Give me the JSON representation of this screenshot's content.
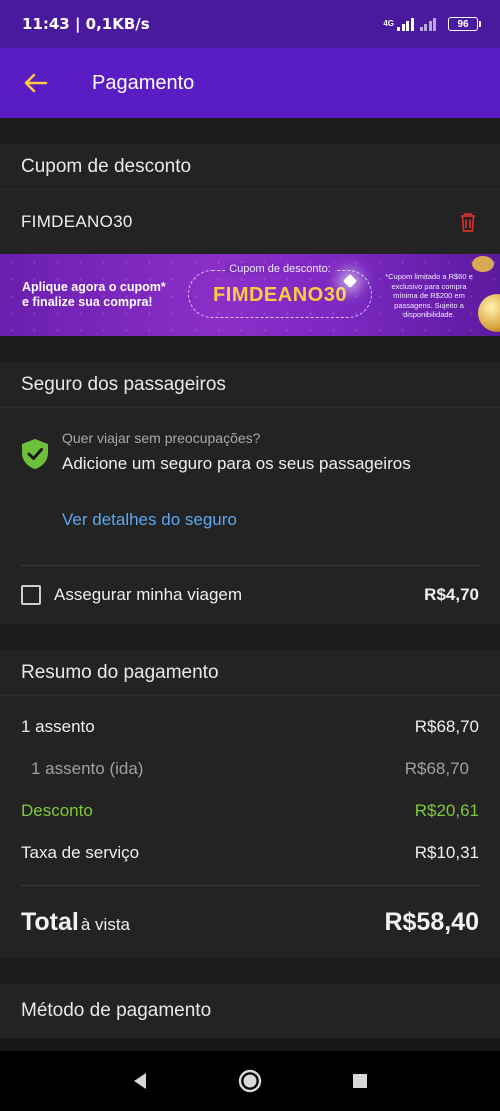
{
  "status_bar": {
    "time": "11:43 | 0,1KB/s",
    "network": "4G",
    "battery": "96"
  },
  "app_bar": {
    "title": "Pagamento",
    "back_icon": "arrow-left-icon"
  },
  "coupon": {
    "header": "Cupom de desconto",
    "code": "FIMDEANO30",
    "delete_icon": "trash-icon",
    "banner": {
      "left_text_1": "Aplique agora o cupom*",
      "left_text_2": "e finalize sua compra!",
      "box_label": "Cupom de desconto:",
      "box_code": "FIMDEANO30",
      "note": "*Cupom limitado a R$60 e exclusivo para compra mínima de R$200 em passagens. Sujeito a disponibilidade."
    }
  },
  "insurance": {
    "header": "Seguro dos passageiros",
    "question": "Quer viajar sem preocupações?",
    "main_text": "Adicione um seguro para os seus passageiros",
    "details_link": "Ver detalhes do seguro",
    "checkbox_label": "Assegurar minha viagem",
    "price": "R$4,70"
  },
  "summary": {
    "header": "Resumo do pagamento",
    "rows": [
      {
        "label": "1 assento",
        "value": "R$68,70"
      },
      {
        "label": "1 assento (ida)",
        "value": "R$68,70"
      },
      {
        "label": "Desconto",
        "value": "R$20,61"
      },
      {
        "label": "Taxa de serviço",
        "value": "R$10,31"
      }
    ],
    "total_label": "Total",
    "total_sub": "à vista",
    "total_value": "R$58,40"
  },
  "payment_method": {
    "header": "Método de pagamento"
  },
  "colors": {
    "app_bar": "#5a1dc4",
    "accent_link": "#5aa8f0",
    "discount": "#7fc83a",
    "shield": "#6cc03a",
    "trash": "#d0302a",
    "coupon_gold": "#ffc940"
  }
}
